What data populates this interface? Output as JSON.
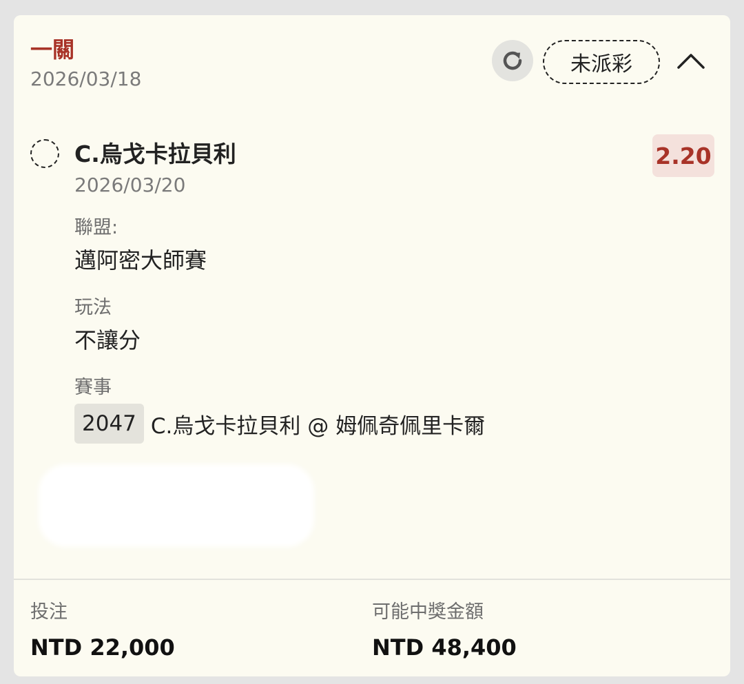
{
  "header": {
    "bet_type": "一關",
    "date": "2026/03/18",
    "status": "未派彩",
    "icons": {
      "refresh": "refresh-icon",
      "collapse": "chevron-up-icon"
    }
  },
  "selection": {
    "name": "C.烏戈卡拉貝利",
    "date": "2026/03/20",
    "odds": "2.20",
    "league_label": "聯盟:",
    "league_value": "邁阿密大師賽",
    "market_label": "玩法",
    "market_value": "不讓分",
    "event_label": "賽事",
    "event_code": "2047",
    "event_name": "C.烏戈卡拉貝利 @ 姆佩奇佩里卡爾"
  },
  "footer": {
    "stake_label": "投注",
    "stake_value": "NTD 22,000",
    "payout_label": "可能中獎金額",
    "payout_value": "NTD 48,400"
  },
  "colors": {
    "accent": "#a83328",
    "odds_bg": "#f4e1dc",
    "card_bg": "#fcfbf1"
  }
}
